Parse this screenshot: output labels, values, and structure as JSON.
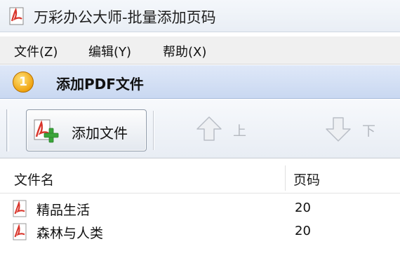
{
  "window": {
    "title": "万彩办公大师-批量添加页码"
  },
  "menubar": {
    "items": [
      "文件(Z)",
      "编辑(Y)",
      "帮助(X)"
    ]
  },
  "section": {
    "badge": "1",
    "title": "添加PDF文件"
  },
  "toolbar": {
    "add_files_label": "添加文件",
    "move_up_label": "上",
    "move_down_label": "下"
  },
  "table": {
    "columns": [
      "文件名",
      "页码"
    ],
    "rows": [
      {
        "name": "精品生活",
        "pages": "20"
      },
      {
        "name": "森林与人类",
        "pages": "20"
      }
    ]
  },
  "colors": {
    "pdf_icon_red": "#d9352b",
    "plus_green": "#3aa53a",
    "header_blue": "#c9d8f1",
    "disabled_text": "#b4b8bf"
  },
  "icons": {
    "app": "pdf-app-icon",
    "add": "pdf-add-icon",
    "up": "arrow-up-icon",
    "down": "arrow-down-icon",
    "file": "pdf-file-icon"
  }
}
